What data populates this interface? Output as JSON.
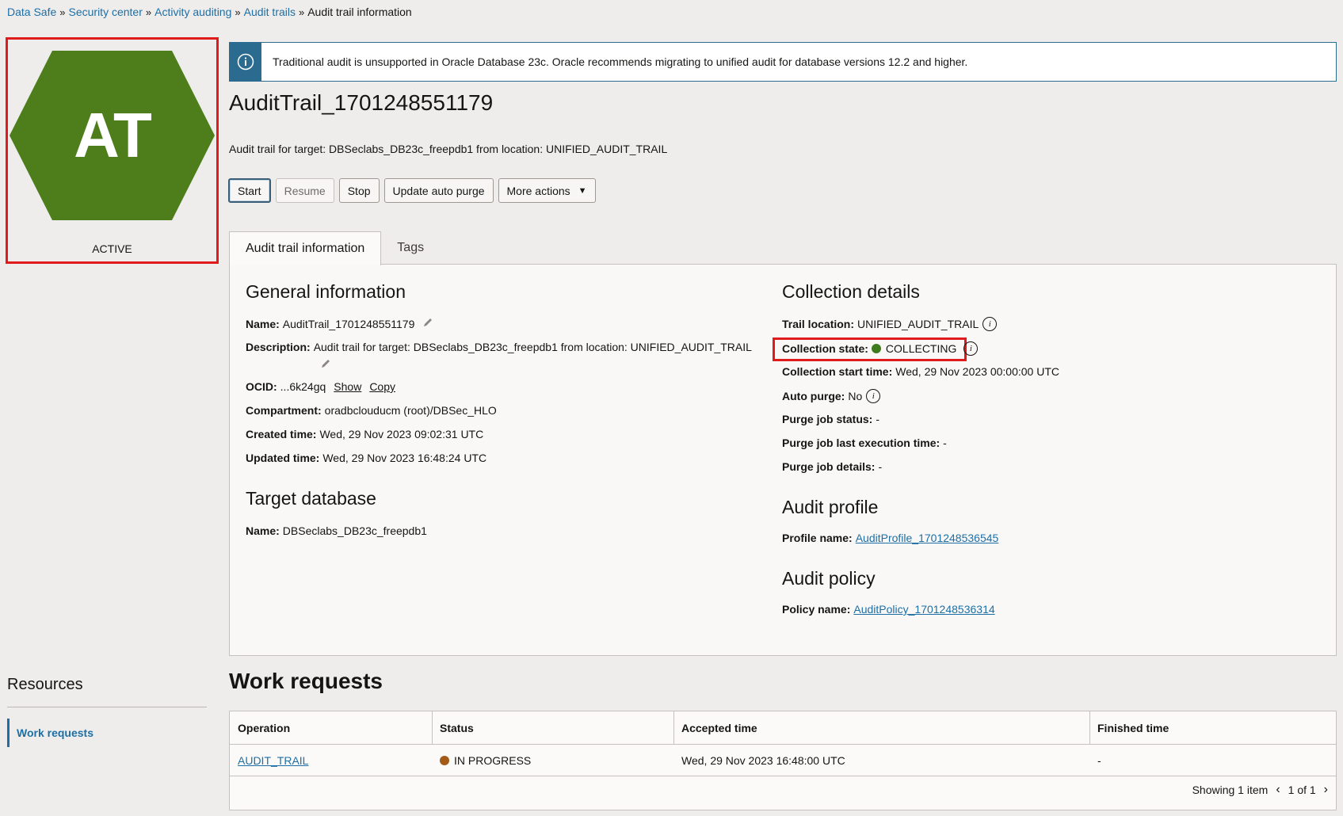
{
  "breadcrumb": {
    "items": [
      "Data Safe",
      "Security center",
      "Activity auditing",
      "Audit trails"
    ],
    "separator": "»",
    "current": "Audit trail information"
  },
  "badge": {
    "initials": "AT",
    "status": "ACTIVE",
    "color": "#4e7e1b"
  },
  "banner": {
    "icon": "info-icon",
    "text": "Traditional audit is unsupported in Oracle Database 23c. Oracle recommends migrating to unified audit for database versions 12.2 and higher."
  },
  "header": {
    "title": "AuditTrail_1701248551179",
    "subtitle": "Audit trail for target: DBSeclabs_DB23c_freepdb1 from location: UNIFIED_AUDIT_TRAIL"
  },
  "actions": {
    "start": "Start",
    "resume": "Resume",
    "stop": "Stop",
    "update_auto_purge": "Update auto purge",
    "more_actions": "More actions"
  },
  "tabs": [
    {
      "label": "Audit trail information",
      "active": true
    },
    {
      "label": "Tags",
      "active": false
    }
  ],
  "general": {
    "title": "General information",
    "name_label": "Name:",
    "name_value": "AuditTrail_1701248551179",
    "description_label": "Description:",
    "description_value": "Audit trail for target: DBSeclabs_DB23c_freepdb1 from location: UNIFIED_AUDIT_TRAIL",
    "ocid_label": "OCID:",
    "ocid_value": "...6k24gq",
    "ocid_show": "Show",
    "ocid_copy": "Copy",
    "compartment_label": "Compartment:",
    "compartment_value": "oradbclouducm (root)/DBSec_HLO",
    "created_label": "Created time:",
    "created_value": "Wed, 29 Nov 2023 09:02:31 UTC",
    "updated_label": "Updated time:",
    "updated_value": "Wed, 29 Nov 2023 16:48:24 UTC"
  },
  "target": {
    "title": "Target database",
    "name_label": "Name:",
    "name_value": "DBSeclabs_DB23c_freepdb1"
  },
  "collection": {
    "title": "Collection details",
    "trail_location_label": "Trail location:",
    "trail_location_value": "UNIFIED_AUDIT_TRAIL",
    "state_label": "Collection state:",
    "state_value": "COLLECTING",
    "state_color": "#3f7a1e",
    "start_time_label": "Collection start time:",
    "start_time_value": "Wed, 29 Nov 2023 00:00:00 UTC",
    "auto_purge_label": "Auto purge:",
    "auto_purge_value": "No",
    "purge_status_label": "Purge job status:",
    "purge_status_value": "-",
    "purge_last_label": "Purge job last execution time:",
    "purge_last_value": "-",
    "purge_details_label": "Purge job details:",
    "purge_details_value": "-"
  },
  "profile": {
    "title": "Audit profile",
    "label": "Profile name:",
    "value": "AuditProfile_1701248536545"
  },
  "policy": {
    "title": "Audit policy",
    "label": "Policy name:",
    "value": "AuditPolicy_1701248536314"
  },
  "resources": {
    "title": "Resources",
    "items": [
      "Work requests"
    ]
  },
  "work_requests": {
    "title": "Work requests",
    "columns": [
      "Operation",
      "Status",
      "Accepted time",
      "Finished time"
    ],
    "rows": [
      {
        "operation": "AUDIT_TRAIL",
        "status": "IN PROGRESS",
        "status_color": "#a35a16",
        "accepted": "Wed, 29 Nov 2023 16:48:00 UTC",
        "finished": "-"
      }
    ],
    "showing": "Showing 1 item",
    "page": "1 of 1"
  }
}
